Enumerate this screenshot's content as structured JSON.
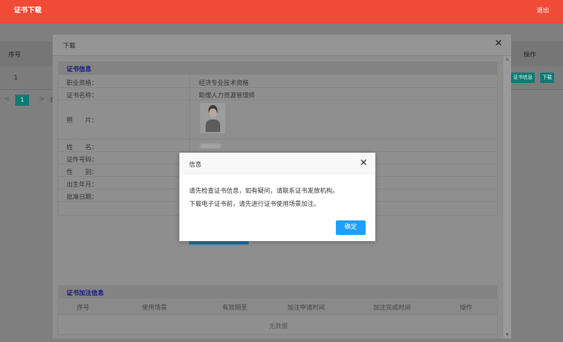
{
  "header": {
    "tab_label": "证书下载",
    "logout_label": "退出",
    "accent_color": "#f14a36"
  },
  "background_table": {
    "columns": {
      "seq": "序号",
      "operation": "操作"
    },
    "rows": [
      {
        "seq": "1",
        "cert_info_button": "证书信息",
        "download_button": "下载"
      }
    ],
    "pager": {
      "prev": "<",
      "current": "1",
      "next": ">",
      "trailing": "到"
    }
  },
  "download_modal": {
    "title": "下载",
    "close_icon": "close-icon",
    "cert_section": {
      "title": "证书信息",
      "rows": [
        {
          "label": "职业资格：",
          "value": "经济专业技术资格"
        },
        {
          "label": "证书名称：",
          "value": "助理人力资源管理师"
        },
        {
          "label": "照　　片：",
          "value": ""
        },
        {
          "label": "姓　　名：",
          "value": ""
        },
        {
          "label": "证件号码：",
          "value": ""
        },
        {
          "label": "性　　别：",
          "value": ""
        },
        {
          "label": "出生年月：",
          "value": ""
        },
        {
          "label": "批准日期：",
          "value": ""
        }
      ]
    },
    "annotation_section": {
      "title": "证书加注信息",
      "columns": [
        "序号",
        "使用场景",
        "有效期至",
        "加注申请时间",
        "加注完成时间",
        "操作"
      ],
      "empty_text": "无数据"
    }
  },
  "alert_dialog": {
    "title": "信息",
    "message_line1": "请先检查证书信息，如有疑问，请联系证书发放机构。",
    "message_line2": "下载电子证书前，请先进行证书使用场景加注。",
    "ok_label": "确定",
    "ok_color": "#1e9fff"
  }
}
